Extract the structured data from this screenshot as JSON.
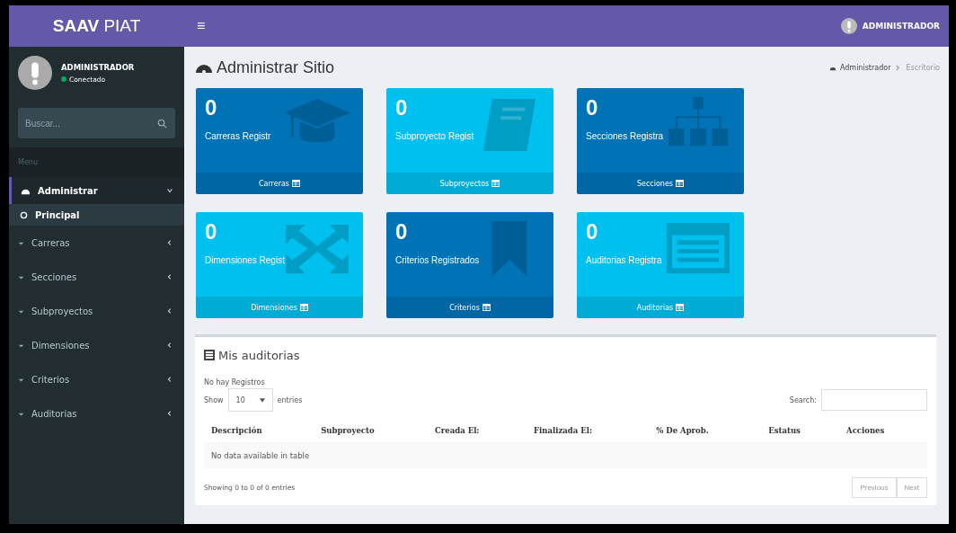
{
  "header": {
    "logo_bold": "SAAV",
    "logo_light": "PIAT",
    "menu_toggle": "≡",
    "user": "ADMINISTRADOR"
  },
  "sidebar": {
    "user": {
      "name": "ADMINISTRADOR",
      "status": "Conectado",
      "online": true
    },
    "search": {
      "placeholder": "Buscar..."
    },
    "section": "Menu",
    "items": [
      {
        "label": "Administrar",
        "expanded": true,
        "children": [
          {
            "label": "Principal",
            "selected": true
          }
        ]
      },
      {
        "label": "Carreras",
        "expanded": false
      },
      {
        "label": "Secciones",
        "expanded": false
      },
      {
        "label": "Subproyectos",
        "expanded": false
      },
      {
        "label": "Dimensiones",
        "expanded": false
      },
      {
        "label": "Criterios",
        "expanded": false
      },
      {
        "label": "Auditorias",
        "expanded": false
      }
    ]
  },
  "page": {
    "title": "Administrar Sitio",
    "breadcrumb": [
      "Administrador",
      "Escritorio"
    ]
  },
  "cards": [
    {
      "count": "0",
      "label": "Carreras Registr",
      "link": "Carreras",
      "color": "#0073b7",
      "kind": "graduation"
    },
    {
      "count": "0",
      "label": "Subproyecto Regist",
      "link": "Subproyectos",
      "color": "#00c0ef",
      "kind": "book"
    },
    {
      "count": "0",
      "label": "Secciones Registra",
      "link": "Secciones",
      "color": "#0073b7",
      "kind": "sitemap"
    },
    {
      "count": "0",
      "label": "Dimensiones Regist",
      "link": "Dimensiones",
      "color": "#00c0ef",
      "kind": "arrows"
    },
    {
      "count": "0",
      "label": "Criterios Registrados",
      "link": "Criterios",
      "color": "#0073b7",
      "kind": "bookmark"
    },
    {
      "count": "0",
      "label": "Auditorias Registra",
      "link": "Auditorias",
      "color": "#00c0ef",
      "kind": "list"
    }
  ],
  "audits": {
    "title": "Mis auditorias",
    "notice": "No hay Registros",
    "show": "Show",
    "length": "10",
    "entries": "entries",
    "search_label": "Search:",
    "columns": [
      "Descripción",
      "Subproyecto",
      "Creada El:",
      "Finalizada El:",
      "% De Aprob.",
      "Estatus",
      "Acciones"
    ],
    "empty": "No data available in table",
    "info": "Showing 0 to 0 of 0 entries",
    "pagination": [
      "Previous",
      "Next"
    ]
  }
}
